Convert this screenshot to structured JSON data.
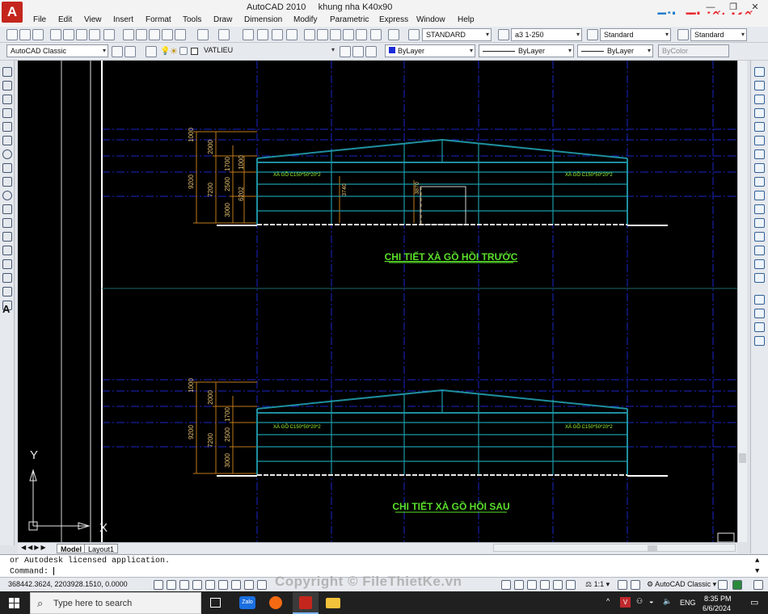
{
  "window": {
    "app": "AutoCAD 2010",
    "doc": "khung nha K40x90"
  },
  "watermark": {
    "brand_file": "File",
    "brand_rest": "Thiết Kế",
    "brand_tld": ".vn",
    "copyright": "Copyright © FileThietKe.vn"
  },
  "menu": [
    "File",
    "Edit",
    "View",
    "Insert",
    "Format",
    "Tools",
    "Draw",
    "Dimension",
    "Modify",
    "Parametric",
    "Express",
    "Window",
    "Help"
  ],
  "toolbar1": {
    "text_style": "STANDARD",
    "dim_style": "a3 1-250",
    "table_style": "Standard",
    "ml_style": "Standard"
  },
  "toolbar2": {
    "workspace": "AutoCAD Classic",
    "layer": "VATLIEU",
    "color": "ByLayer",
    "linetype": "ByLayer",
    "lineweight": "ByLayer",
    "plotstyle": "ByColor"
  },
  "drawing": {
    "view_top": {
      "title": "CHI TIẾT XÀ GỒ HỒI TRƯỚC",
      "purlin_left": "XÀ GỒ C150*50*20*2",
      "purlin_right": "XÀ GỒ C150*50*20*2",
      "dims_outer": "9200",
      "dims_mid": [
        "2000",
        "7200"
      ],
      "dims_inner": [
        "1000",
        "1700",
        "2500",
        "3000"
      ],
      "dim_6202": "6202",
      "dim_1000b": "1000",
      "door_h1": "3740",
      "door_h2": "3870"
    },
    "view_bottom": {
      "title": "CHI TIẾT XÀ GỒ HỒI SAU",
      "purlin_left": "XÀ GỒ C150*50*20*2",
      "purlin_right": "XÀ GỒ C150*50*20*2",
      "dims_outer": "9200",
      "dims_mid": [
        "2000",
        "7200"
      ],
      "dims_inner": [
        "1000",
        "1700",
        "2500",
        "3000"
      ]
    },
    "ucs_y": "Y",
    "ucs_x": "X"
  },
  "tabs": [
    "Model",
    "Layout1"
  ],
  "command": {
    "history": "or Autodesk licensed application.",
    "prompt": "Command:"
  },
  "status": {
    "coords": "368442.3624, 2203928.1510, 0.0000",
    "scale": "1:1",
    "workspace": "AutoCAD Classic"
  },
  "taskbar": {
    "search": "Type here to search",
    "time": "8:35 PM",
    "date": "6/6/2024",
    "lang": "ENG"
  }
}
